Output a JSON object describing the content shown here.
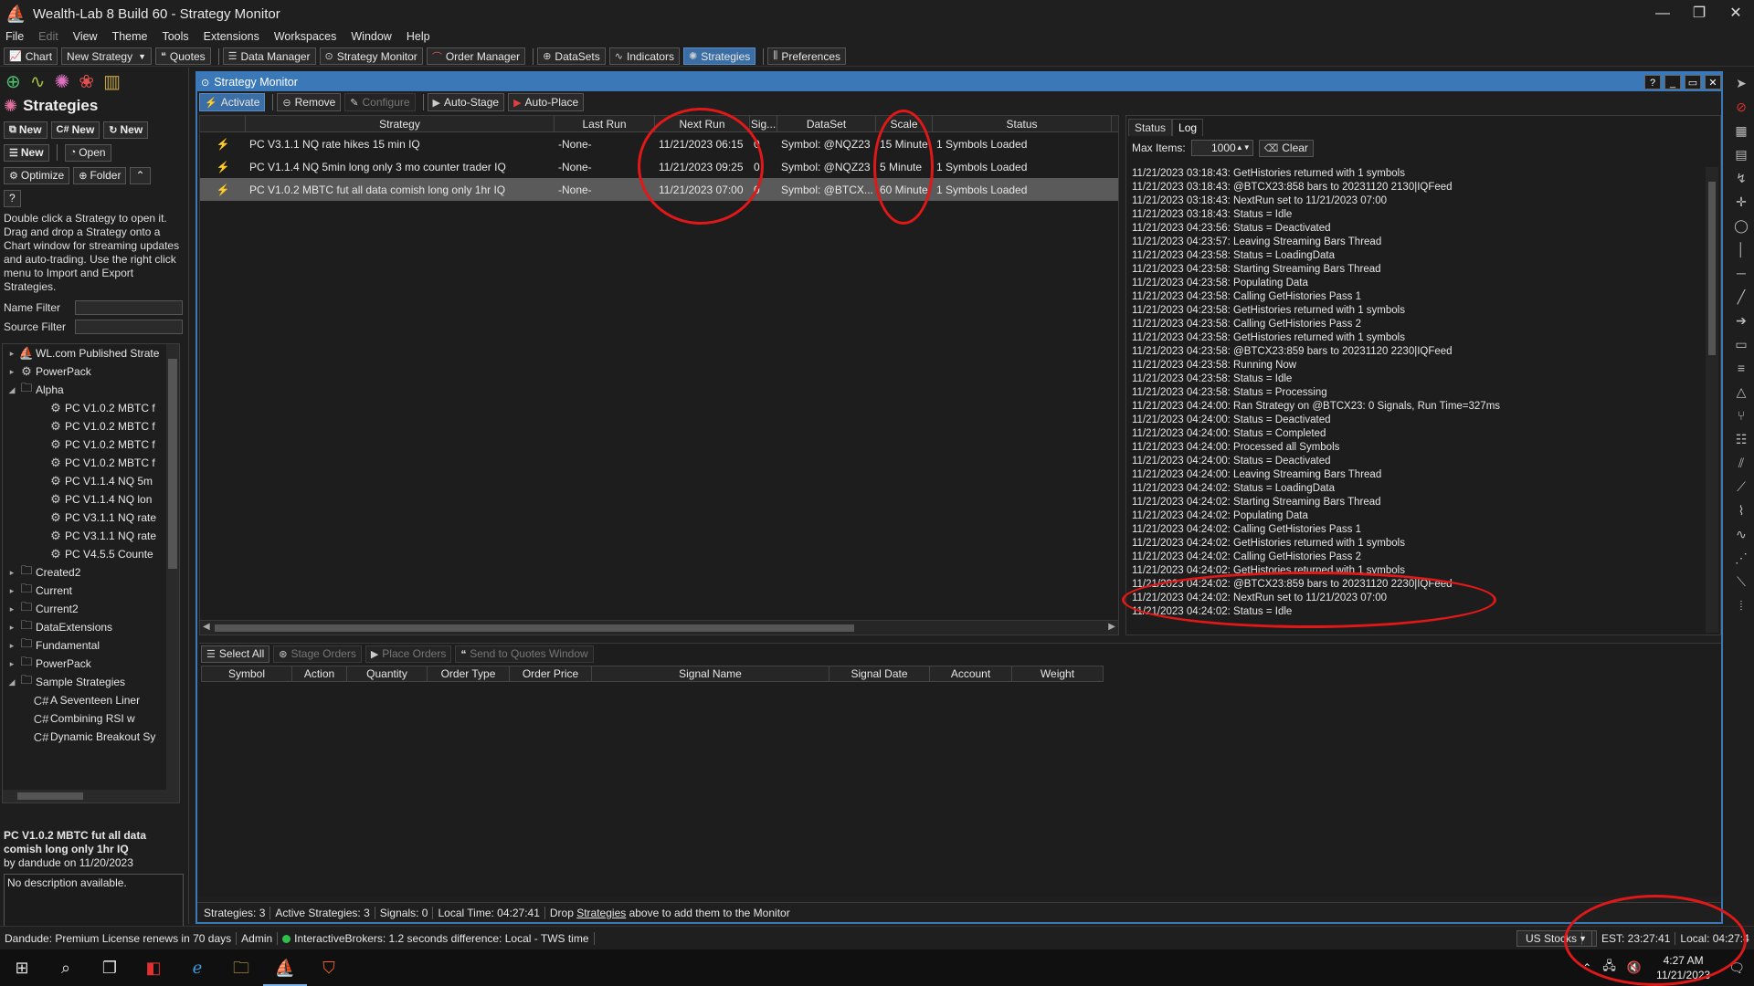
{
  "window": {
    "title": "Wealth-Lab 8 Build 60 - Strategy Monitor"
  },
  "menu": [
    "File",
    "Edit",
    "View",
    "Theme",
    "Tools",
    "Extensions",
    "Workspaces",
    "Window",
    "Help"
  ],
  "toolbar": {
    "chart": "Chart",
    "new_strategy": "New Strategy",
    "quotes": "Quotes",
    "data_manager": "Data Manager",
    "strategy_monitor": "Strategy Monitor",
    "order_manager": "Order Manager",
    "datasets": "DataSets",
    "indicators": "Indicators",
    "strategies": "Strategies",
    "preferences": "Preferences"
  },
  "left_panel": {
    "title": "Strategies",
    "buttons": {
      "new1": "New",
      "new_cs": "New",
      "new_rev": "New",
      "new2": "New",
      "open": "Open",
      "optimize": "Optimize",
      "folder": "Folder",
      "help": "?"
    },
    "help_text": "Double click a Strategy to open it. Drag and drop a Strategy onto a Chart window for streaming updates and auto-trading. Use the right click menu to Import and Export Strategies.",
    "name_filter": "Name Filter",
    "source_filter": "Source Filter",
    "tree": [
      {
        "label": "WL.com Published Strate",
        "indent": 0,
        "arrow": "▸",
        "icon": "⛵"
      },
      {
        "label": "PowerPack",
        "indent": 0,
        "arrow": "▸",
        "icon": "⚙"
      },
      {
        "label": "Alpha",
        "indent": 0,
        "arrow": "◢",
        "icon": "🗀"
      },
      {
        "label": "PC V1.0.2 MBTC f",
        "indent": 2,
        "arrow": "",
        "icon": "⚙"
      },
      {
        "label": "PC V1.0.2 MBTC f",
        "indent": 2,
        "arrow": "",
        "icon": "⚙"
      },
      {
        "label": "PC V1.0.2 MBTC f",
        "indent": 2,
        "arrow": "",
        "icon": "⚙"
      },
      {
        "label": "PC V1.0.2 MBTC f",
        "indent": 2,
        "arrow": "",
        "icon": "⚙"
      },
      {
        "label": "PC V1.1.4 NQ 5m",
        "indent": 2,
        "arrow": "",
        "icon": "⚙"
      },
      {
        "label": "PC V1.1.4 NQ lon",
        "indent": 2,
        "arrow": "",
        "icon": "⚙"
      },
      {
        "label": "PC V3.1.1 NQ rate",
        "indent": 2,
        "arrow": "",
        "icon": "⚙"
      },
      {
        "label": "PC V3.1.1 NQ rate",
        "indent": 2,
        "arrow": "",
        "icon": "⚙"
      },
      {
        "label": "PC V4.5.5 Counte",
        "indent": 2,
        "arrow": "",
        "icon": "⚙"
      },
      {
        "label": "Created2",
        "indent": 0,
        "arrow": "▸",
        "icon": "🗀"
      },
      {
        "label": "Current",
        "indent": 0,
        "arrow": "▸",
        "icon": "🗀"
      },
      {
        "label": "Current2",
        "indent": 0,
        "arrow": "▸",
        "icon": "🗀"
      },
      {
        "label": "DataExtensions",
        "indent": 0,
        "arrow": "▸",
        "icon": "🗀"
      },
      {
        "label": "Fundamental",
        "indent": 0,
        "arrow": "▸",
        "icon": "🗀"
      },
      {
        "label": "PowerPack",
        "indent": 0,
        "arrow": "▸",
        "icon": "🗀"
      },
      {
        "label": "Sample Strategies",
        "indent": 0,
        "arrow": "◢",
        "icon": "🗀"
      },
      {
        "label": "A Seventeen Liner",
        "indent": 1,
        "arrow": "",
        "icon": "C#"
      },
      {
        "label": "Combining RSI w",
        "indent": 1,
        "arrow": "",
        "icon": "C#"
      },
      {
        "label": "Dynamic Breakout Sy",
        "indent": 1,
        "arrow": "",
        "icon": "C#"
      }
    ],
    "selected_name": "PC V1.0.2 MBTC fut all data comish long only 1hr IQ",
    "selected_by": "by dandude on 11/20/2023",
    "description": "No description available."
  },
  "monitor": {
    "title": "Strategy Monitor",
    "buttons": {
      "activate": "Activate",
      "remove": "Remove",
      "configure": "Configure",
      "auto_stage": "Auto-Stage",
      "auto_place": "Auto-Place"
    },
    "columns": [
      "",
      "Strategy",
      "Last Run",
      "Next Run",
      "Sig...",
      "DataSet",
      "Scale",
      "Status"
    ],
    "rows": [
      {
        "strategy": "PC V3.1.1 NQ rate hikes 15 min IQ",
        "last_run": "-None-",
        "next_run": "11/21/2023 06:15",
        "signals": "0",
        "dataset": "Symbol: @NQZ23",
        "scale": "15 Minute",
        "status": "1 Symbols Loaded",
        "selected": false
      },
      {
        "strategy": "PC V1.1.4 NQ 5min long only 3 mo counter trader IQ",
        "last_run": "-None-",
        "next_run": "11/21/2023 09:25",
        "signals": "0",
        "dataset": "Symbol: @NQZ23",
        "scale": "5 Minute",
        "status": "1 Symbols Loaded",
        "selected": false
      },
      {
        "strategy": "PC V1.0.2 MBTC fut all data comish long only 1hr IQ",
        "last_run": "-None-",
        "next_run": "11/21/2023 07:00",
        "signals": "0",
        "dataset": "Symbol: @BTCX...",
        "scale": "60 Minute",
        "status": "1 Symbols Loaded",
        "selected": true
      }
    ],
    "log_tabs": [
      "Status",
      "Log"
    ],
    "max_items_label": "Max Items:",
    "max_items_value": "1000",
    "clear": "Clear",
    "log": [
      "11/21/2023 03:18:43: GetHistories returned with 1 symbols",
      "11/21/2023 03:18:43: @BTCX23:858 bars to 20231120 2130|IQFeed",
      "11/21/2023 03:18:43: NextRun set to 11/21/2023 07:00",
      "11/21/2023 03:18:43: Status = Idle",
      "11/21/2023 04:23:56: Status = Deactivated",
      "11/21/2023 04:23:57: Leaving Streaming Bars Thread",
      "11/21/2023 04:23:58: Status = LoadingData",
      "11/21/2023 04:23:58: Starting Streaming Bars Thread",
      "11/21/2023 04:23:58: Populating Data",
      "11/21/2023 04:23:58: Calling GetHistories Pass 1",
      "11/21/2023 04:23:58: GetHistories returned with 1 symbols",
      "11/21/2023 04:23:58: Calling GetHistories Pass 2",
      "11/21/2023 04:23:58: GetHistories returned with 1 symbols",
      "11/21/2023 04:23:58: @BTCX23:859 bars to 20231120 2230|IQFeed",
      "11/21/2023 04:23:58: Running Now",
      "11/21/2023 04:23:58: Status = Idle",
      "11/21/2023 04:23:58: Status = Processing",
      "11/21/2023 04:24:00: Ran Strategy on @BTCX23: 0 Signals, Run Time=327ms",
      "11/21/2023 04:24:00: Status = Deactivated",
      "11/21/2023 04:24:00: Status = Completed",
      "11/21/2023 04:24:00: Processed all Symbols",
      "11/21/2023 04:24:00: Status = Deactivated",
      "11/21/2023 04:24:00: Leaving Streaming Bars Thread",
      "11/21/2023 04:24:02: Status = LoadingData",
      "11/21/2023 04:24:02: Starting Streaming Bars Thread",
      "11/21/2023 04:24:02: Populating Data",
      "11/21/2023 04:24:02: Calling GetHistories Pass 1",
      "11/21/2023 04:24:02: GetHistories returned with 1 symbols",
      "11/21/2023 04:24:02: Calling GetHistories Pass 2",
      "11/21/2023 04:24:02: GetHistories returned with 1 symbols",
      "11/21/2023 04:24:02: @BTCX23:859 bars to 20231120 2230|IQFeed",
      "11/21/2023 04:24:02: NextRun set to 11/21/2023 07:00",
      "11/21/2023 04:24:02: Status = Idle"
    ],
    "order_buttons": {
      "select_all": "Select All",
      "stage_orders": "Stage Orders",
      "place_orders": "Place Orders",
      "send_to_quotes": "Send to Quotes Window"
    },
    "order_columns": [
      "Symbol",
      "Action",
      "Quantity",
      "Order Type",
      "Order Price",
      "Signal Name",
      "Signal Date",
      "Account",
      "Weight"
    ],
    "status": {
      "strategies": "Strategies: 3",
      "active": "Active Strategies: 3",
      "signals": "Signals: 0",
      "local_time": "Local Time: 04:27:41",
      "drop_pre": "Drop ",
      "drop_link": "Strategies",
      "drop_post": " above to add them to the Monitor"
    }
  },
  "app_status": {
    "license": "Dandude: Premium License renews in 70 days",
    "user": "Admin",
    "broker": "InteractiveBrokers: 1.2 seconds difference: Local - TWS time",
    "market": "US Stocks",
    "est": "EST: 23:27:41",
    "local": "Local: 04:27:4"
  },
  "taskbar": {
    "time": "4:27 AM",
    "date": "11/21/2023"
  },
  "colors": {
    "accent": "#3a78b8",
    "annotation": "#e01818",
    "connected": "#2ec04a"
  }
}
